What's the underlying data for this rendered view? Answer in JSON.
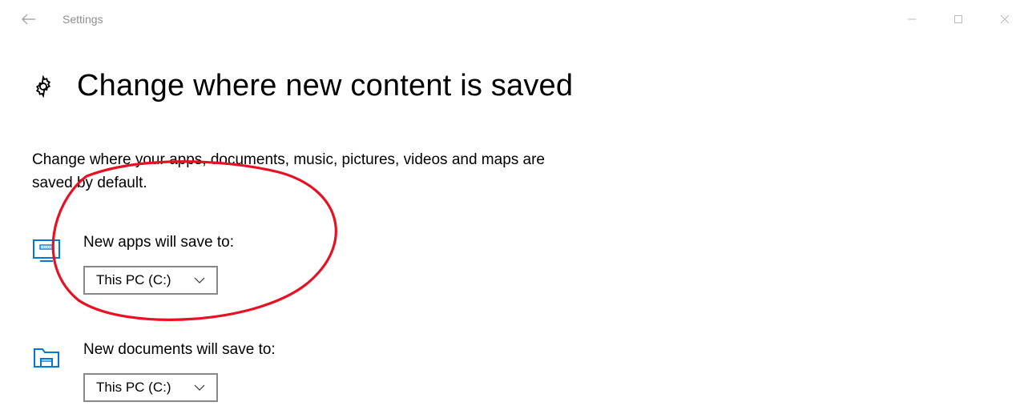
{
  "window": {
    "app_title": "Settings"
  },
  "page": {
    "title": "Change where new content is saved",
    "description": "Change where your apps, documents, music, pictures, videos and maps are saved by default."
  },
  "settings": {
    "apps": {
      "label": "New apps will save to:",
      "value": "This PC (C:)"
    },
    "documents": {
      "label": "New documents will save to:",
      "value": "This PC (C:)"
    }
  },
  "colors": {
    "accent": "#0078d7",
    "annotation": "#e81123"
  }
}
